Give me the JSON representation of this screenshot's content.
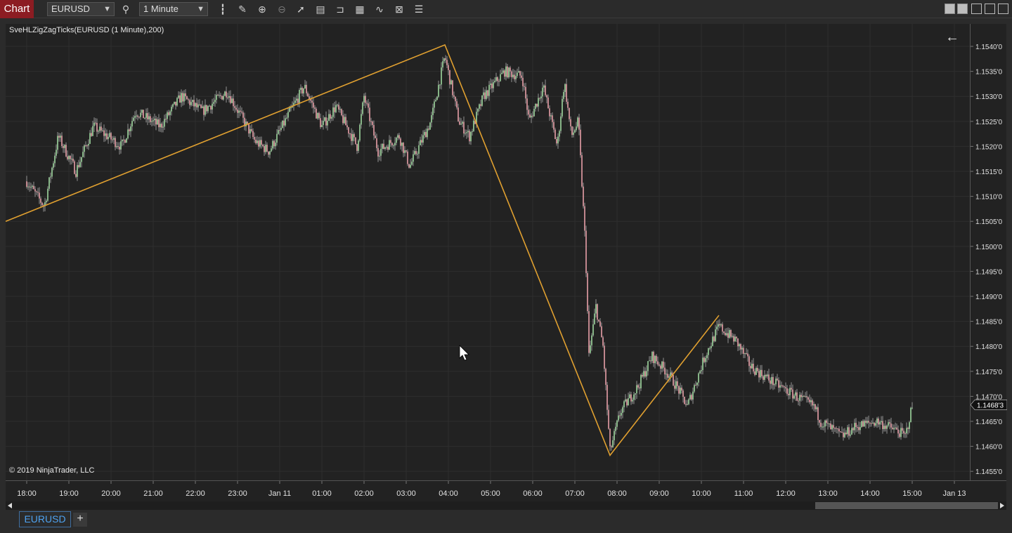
{
  "toolbar": {
    "chart_label": "Chart",
    "instrument": "EURUSD",
    "interval": "1 Minute",
    "icons": [
      "search-icon",
      "bar-style-icon",
      "draw-icon",
      "zoom-in-icon",
      "zoom-out-icon",
      "pointer-icon",
      "data-box-icon",
      "templates-icon",
      "strategies-icon",
      "indicators-icon",
      "properties-icon",
      "list-icon"
    ]
  },
  "chart": {
    "indicator_label": "SveHLZigZagTicks(EURUSD (1 Minute),200)",
    "copyright": "© 2019 NinjaTrader, LLC",
    "current_price": "1.1468'3",
    "price_ticks": [
      "1.1540'0",
      "1.1535'0",
      "1.1530'0",
      "1.1525'0",
      "1.1520'0",
      "1.1515'0",
      "1.1510'0",
      "1.1505'0",
      "1.1500'0",
      "1.1495'0",
      "1.1490'0",
      "1.1485'0",
      "1.1480'0",
      "1.1475'0",
      "1.1470'0",
      "1.1465'0",
      "1.1460'0",
      "1.1455'0"
    ],
    "time_ticks": [
      "18:00",
      "19:00",
      "20:00",
      "21:00",
      "22:00",
      "23:00",
      "Jan 11",
      "01:00",
      "02:00",
      "03:00",
      "04:00",
      "05:00",
      "06:00",
      "07:00",
      "08:00",
      "09:00",
      "10:00",
      "11:00",
      "12:00",
      "13:00",
      "14:00",
      "15:00",
      "Jan 13"
    ]
  },
  "chart_data": {
    "type": "candlestick",
    "instrument": "EURUSD",
    "interval": "1 Minute",
    "ylim": [
      1.14532,
      1.15445
    ],
    "zigzag": [
      {
        "t": "17:30",
        "p": 1.1505
      },
      {
        "t": "03:55",
        "p": 1.15403
      },
      {
        "t": "07:50",
        "p": 1.14582
      },
      {
        "t": "10:25",
        "p": 1.14862
      }
    ],
    "price_path": [
      {
        "t": "18:00",
        "p": 1.1513
      },
      {
        "t": "18:25",
        "p": 1.1508
      },
      {
        "t": "18:45",
        "p": 1.1522
      },
      {
        "t": "19:10",
        "p": 1.1515
      },
      {
        "t": "19:35",
        "p": 1.1524
      },
      {
        "t": "20:15",
        "p": 1.152
      },
      {
        "t": "20:35",
        "p": 1.1527
      },
      {
        "t": "21:10",
        "p": 1.1524
      },
      {
        "t": "21:40",
        "p": 1.153
      },
      {
        "t": "22:10",
        "p": 1.1527
      },
      {
        "t": "22:45",
        "p": 1.1531
      },
      {
        "t": "23:25",
        "p": 1.1521
      },
      {
        "t": "23:45",
        "p": 1.1519
      },
      {
        "t": "00:15",
        "p": 1.1527
      },
      {
        "t": "00:35",
        "p": 1.1532
      },
      {
        "t": "01:00",
        "p": 1.1524
      },
      {
        "t": "01:20",
        "p": 1.1528
      },
      {
        "t": "01:50",
        "p": 1.152
      },
      {
        "t": "02:00",
        "p": 1.153
      },
      {
        "t": "02:20",
        "p": 1.1519
      },
      {
        "t": "02:50",
        "p": 1.1522
      },
      {
        "t": "03:05",
        "p": 1.1516
      },
      {
        "t": "03:35",
        "p": 1.1525
      },
      {
        "t": "03:55",
        "p": 1.1538
      },
      {
        "t": "04:15",
        "p": 1.1525
      },
      {
        "t": "04:30",
        "p": 1.1522
      },
      {
        "t": "04:50",
        "p": 1.153
      },
      {
        "t": "05:20",
        "p": 1.1535
      },
      {
        "t": "05:45",
        "p": 1.1534
      },
      {
        "t": "05:55",
        "p": 1.1525
      },
      {
        "t": "06:15",
        "p": 1.1532
      },
      {
        "t": "06:35",
        "p": 1.152
      },
      {
        "t": "06:45",
        "p": 1.1533
      },
      {
        "t": "06:55",
        "p": 1.1522
      },
      {
        "t": "07:05",
        "p": 1.1525
      },
      {
        "t": "07:15",
        "p": 1.15
      },
      {
        "t": "07:20",
        "p": 1.1478
      },
      {
        "t": "07:30",
        "p": 1.1488
      },
      {
        "t": "07:40",
        "p": 1.148
      },
      {
        "t": "07:50",
        "p": 1.1459
      },
      {
        "t": "08:05",
        "p": 1.1467
      },
      {
        "t": "08:30",
        "p": 1.1472
      },
      {
        "t": "08:50",
        "p": 1.1478
      },
      {
        "t": "09:10",
        "p": 1.1475
      },
      {
        "t": "09:25",
        "p": 1.1472
      },
      {
        "t": "09:40",
        "p": 1.1468
      },
      {
        "t": "10:05",
        "p": 1.1478
      },
      {
        "t": "10:25",
        "p": 1.1484
      },
      {
        "t": "10:50",
        "p": 1.1481
      },
      {
        "t": "11:10",
        "p": 1.1476
      },
      {
        "t": "11:40",
        "p": 1.1473
      },
      {
        "t": "12:15",
        "p": 1.147
      },
      {
        "t": "12:40",
        "p": 1.1468
      },
      {
        "t": "12:50",
        "p": 1.1465
      },
      {
        "t": "13:20",
        "p": 1.1462
      },
      {
        "t": "13:40",
        "p": 1.1464
      },
      {
        "t": "14:10",
        "p": 1.1465
      },
      {
        "t": "14:40",
        "p": 1.1463
      },
      {
        "t": "14:50",
        "p": 1.1462
      },
      {
        "t": "15:00",
        "p": 1.1468
      }
    ],
    "colors": {
      "up": "#9fd8a0",
      "down": "#e8a0a8",
      "zigzag": "#e0a030",
      "background": "#222222"
    }
  },
  "tabs": {
    "active": "EURUSD",
    "add": "+"
  }
}
